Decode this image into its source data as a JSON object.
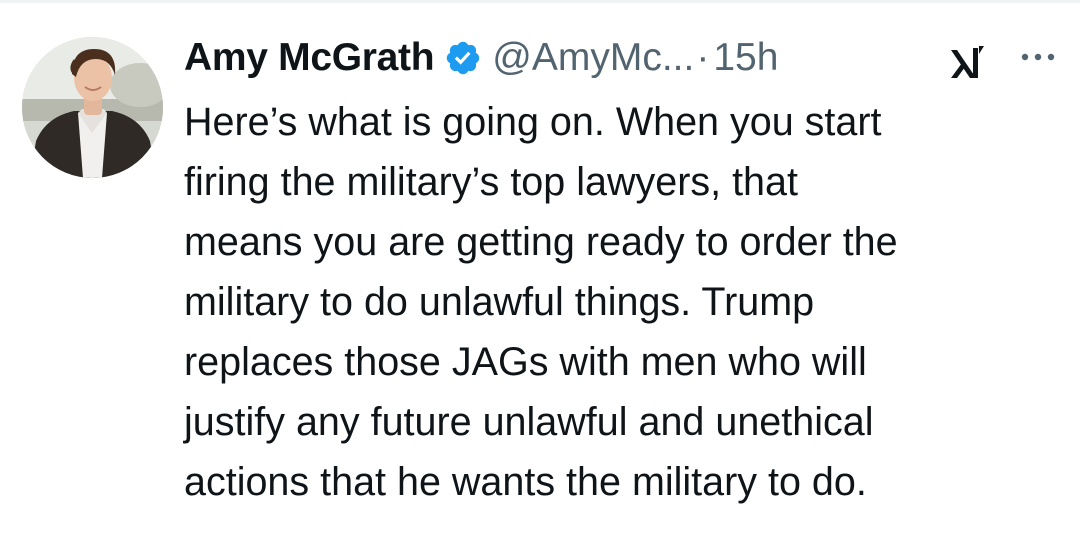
{
  "tweet": {
    "author": {
      "name": "Amy McGrath",
      "handle": "@AmyMc...",
      "verified": true
    },
    "separator": "·",
    "time": "15h",
    "text_lines": [
      "Here’s what is going on. When you start",
      "firing the military’s top lawyers, that",
      "means you are getting ready to order the",
      "military to do unlawful things. Trump",
      "replaces those JAGs with men who will",
      "justify any future unlawful and unethical",
      "actions that he wants the military to do."
    ]
  },
  "icons": {
    "verified": "verified-badge-icon",
    "grok": "grok-icon",
    "more": "more-options-icon"
  },
  "colors": {
    "text": "#0f1419",
    "secondary": "#536471",
    "verified_blue": "#1d9bf0",
    "background": "#ffffff"
  }
}
